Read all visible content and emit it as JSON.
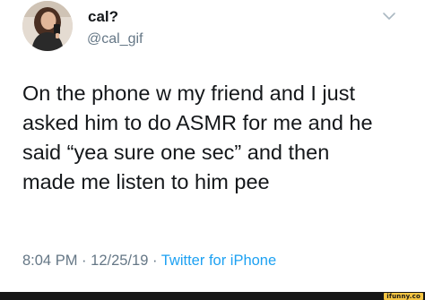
{
  "tweet": {
    "display_name": "cal?",
    "handle": "@cal_gif",
    "text_lines": [
      "On the phone w my friend and I just",
      "asked him to do ASMR for me and he",
      "said “yea sure one sec” and then",
      "made me listen to him pee"
    ],
    "time": "8:04 PM",
    "separator": "·",
    "date": "12/25/19",
    "source": "Twitter for iPhone"
  },
  "icons": {
    "menu": "chevron-down-icon",
    "avatar": "user-avatar"
  },
  "watermark": {
    "text": "ifunny.co"
  },
  "colors": {
    "text": "#14171a",
    "secondary": "#657786",
    "link": "#1da1f2",
    "chevron": "#aab8c2",
    "watermark_bg": "#f5c542",
    "bar": "#161616"
  }
}
